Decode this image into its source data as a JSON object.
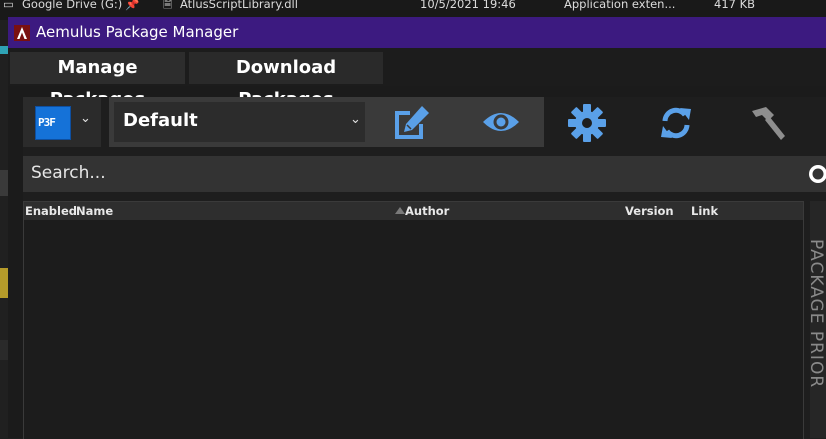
{
  "background": {
    "drive_item": "Google Drive (G:)",
    "file_name": "AtlusScriptLibrary.dll",
    "file_date": "10/5/2021 19:46",
    "file_type": "Application exten...",
    "file_size": "417 KB"
  },
  "window": {
    "title": "Aemulus Package Manager"
  },
  "tabs": [
    {
      "label": "Manage Packages",
      "active": true
    },
    {
      "label": "Download Packages",
      "active": false
    }
  ],
  "toolbar": {
    "game_label": "P3F",
    "loadout_value": "Default",
    "accent_color": "#5aa0e8"
  },
  "search": {
    "placeholder": "Search..."
  },
  "grid": {
    "columns": [
      "Enabled",
      "Name",
      "Author",
      "Version",
      "Link"
    ],
    "rows": []
  },
  "side_panel": {
    "label": "PACKAGE PRIOR"
  }
}
